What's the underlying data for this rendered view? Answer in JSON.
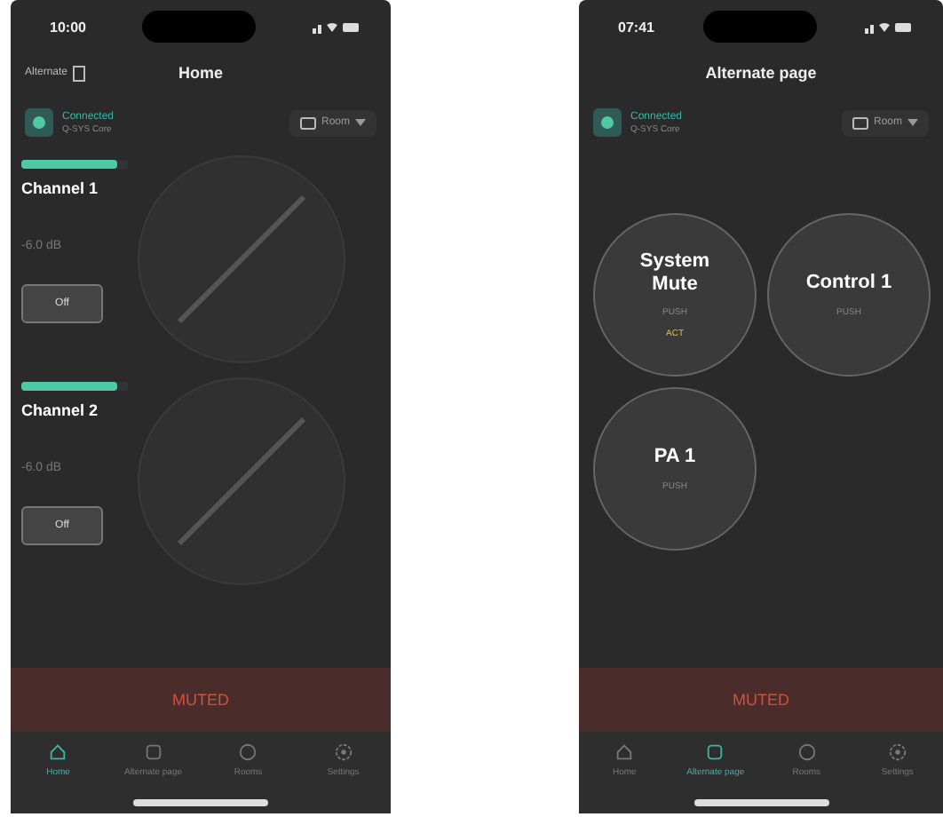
{
  "phones": [
    {
      "kind": "channels",
      "time": "10:00",
      "back_label": "Alternate",
      "title": "Home",
      "connection": {
        "status": "Connected",
        "detail": "Q-SYS Core"
      },
      "selector": "Room",
      "channels": [
        {
          "name": "Channel 1",
          "level": 0.9,
          "reading": "-6.0 dB",
          "button": "Off"
        },
        {
          "name": "Channel 2",
          "level": 0.9,
          "reading": "-6.0 dB",
          "button": "Off"
        }
      ],
      "banner": "MUTED",
      "nav": [
        {
          "label": "Home",
          "selected": true
        },
        {
          "label": "Alternate page",
          "selected": false
        },
        {
          "label": "Rooms",
          "selected": false
        },
        {
          "label": "Settings",
          "selected": false
        }
      ]
    },
    {
      "kind": "buttons",
      "time": "07:41",
      "title": "Alternate page",
      "connection": {
        "status": "Connected",
        "detail": "Q-SYS Core"
      },
      "selector": "Room",
      "buttons": [
        {
          "title": "System Mute",
          "subtitle": "PUSH",
          "status": "ACT"
        },
        {
          "title": "Control 1",
          "subtitle": "PUSH"
        },
        {
          "title": "PA 1",
          "subtitle": "PUSH"
        }
      ],
      "banner": "MUTED",
      "nav": [
        {
          "label": "Home",
          "selected": false
        },
        {
          "label": "Alternate page",
          "selected": true
        },
        {
          "label": "Rooms",
          "selected": false
        },
        {
          "label": "Settings",
          "selected": false
        }
      ]
    }
  ]
}
